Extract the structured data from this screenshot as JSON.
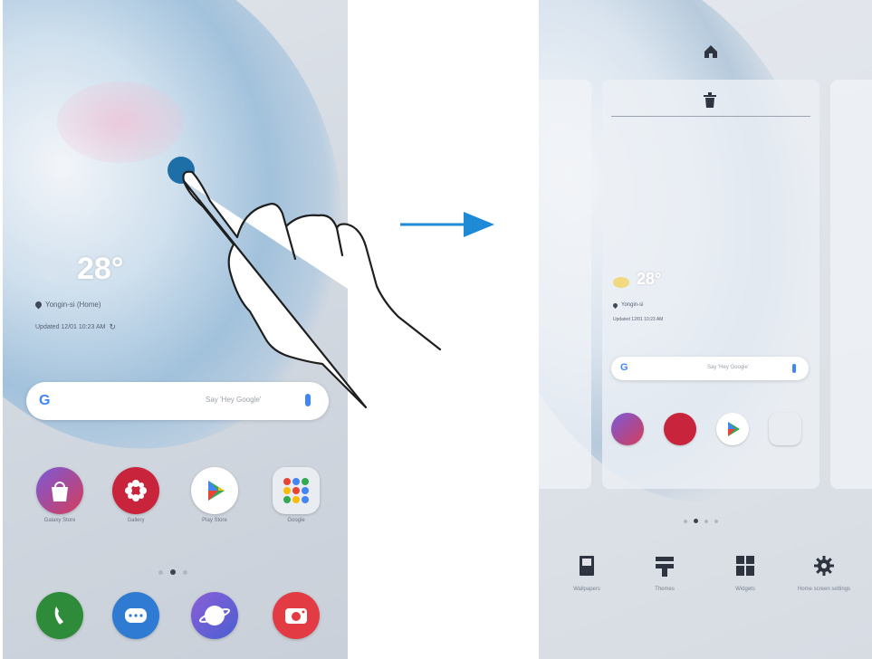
{
  "left_screen": {
    "weather": {
      "temperature": "28°",
      "location": "Yongin-si (Home)",
      "updated": "Updated 12/01 10:23 AM"
    },
    "search": {
      "logo": "G",
      "placeholder": "Say 'Hey Google'"
    },
    "apps": [
      {
        "label": "Galaxy Store",
        "icon": "galaxy-store-icon",
        "color": "#d43d5a"
      },
      {
        "label": "Gallery",
        "icon": "gallery-icon",
        "color": "#c8243c"
      },
      {
        "label": "Play Store",
        "icon": "play-store-icon",
        "color": "#ffffff"
      },
      {
        "label": "Google",
        "icon": "google-folder-icon",
        "color": "#e9edf2"
      }
    ],
    "page_indicator": {
      "count": 3,
      "active": 1
    },
    "dock": [
      {
        "icon": "phone-icon",
        "color": "#2e8b3a"
      },
      {
        "icon": "messages-icon",
        "color": "#2f7ad3"
      },
      {
        "icon": "internet-icon",
        "color": "#6a5fd0"
      },
      {
        "icon": "camera-icon",
        "color": "#e23b43"
      }
    ]
  },
  "arrow": {
    "color": "#1f8ad6"
  },
  "right_screen": {
    "home_icon": "home-icon",
    "trash_icon": "trash-icon",
    "weather": {
      "temperature": "28°",
      "location": "Yongin-si",
      "updated": "Updated 12/01 10:23 AM"
    },
    "search": {
      "logo": "G",
      "placeholder": "Say 'Hey Google'"
    },
    "page_indicator": {
      "count": 4,
      "active": 1
    },
    "options": [
      {
        "label": "Wallpapers",
        "icon": "wallpapers-icon"
      },
      {
        "label": "Themes",
        "icon": "themes-icon"
      },
      {
        "label": "Widgets",
        "icon": "widgets-icon"
      },
      {
        "label": "Home screen settings",
        "icon": "settings-icon"
      }
    ]
  }
}
